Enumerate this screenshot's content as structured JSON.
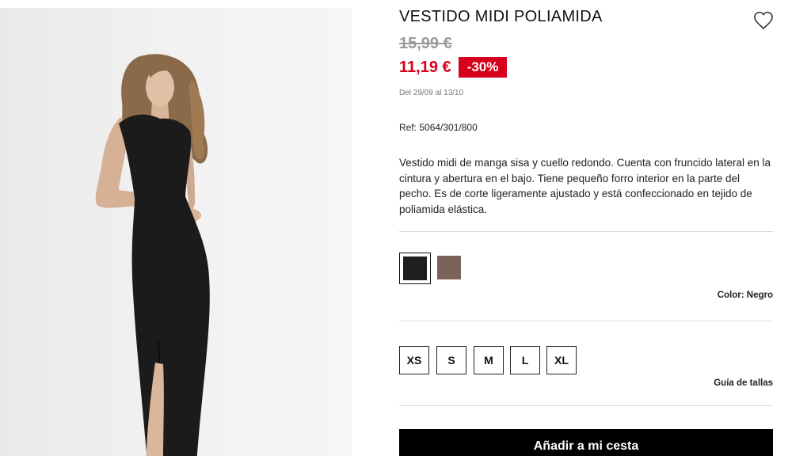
{
  "product": {
    "title": "VESTIDO MIDI POLIAMIDA",
    "old_price": "15,99 €",
    "new_price": "11,19 €",
    "discount": "-30%",
    "dates": "Del 29/09 al 13/10",
    "ref": "Ref: 5064/301/800",
    "description": "Vestido midi de manga sisa y cuello redondo. Cuenta con fruncido lateral en la cintura y abertura en el bajo. Tiene pequeño forro interior en la parte del pecho. Es de corte ligeramente ajustado y está confeccionado en tejido de poliamida elástica."
  },
  "colors": {
    "swatches": [
      {
        "name": "Negro",
        "hex": "#1e1e1e",
        "selected": true
      },
      {
        "name": "Marrón",
        "hex": "#7a6358",
        "selected": false
      }
    ],
    "label": "Color: Negro"
  },
  "sizes": {
    "options": [
      "XS",
      "S",
      "M",
      "L",
      "XL"
    ],
    "guide_label": "Guía de tallas"
  },
  "cart": {
    "button_label": "Añadir a mi cesta"
  },
  "icons": {
    "favorite": "heart-outline-icon"
  },
  "theme": {
    "sale_red": "#d6001c",
    "old_price_gray": "#9a9a9a",
    "button_black": "#000000"
  }
}
